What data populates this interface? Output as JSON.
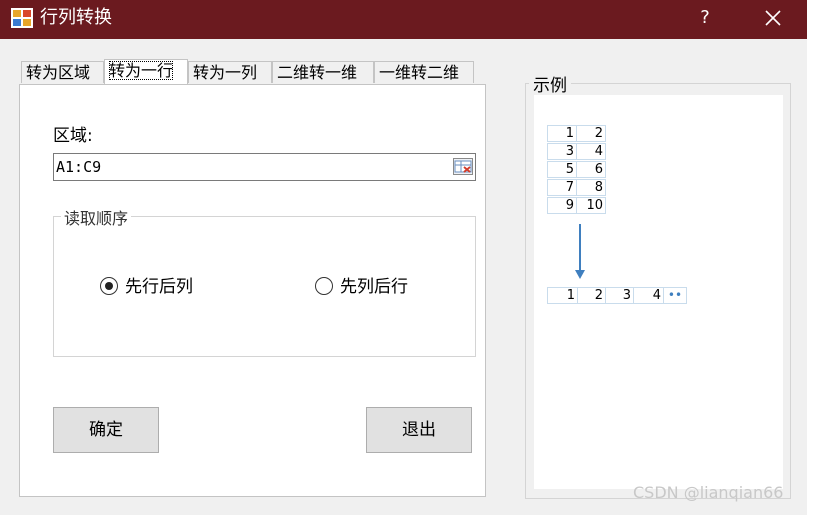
{
  "window": {
    "title": "行列转换",
    "help_label": "?"
  },
  "tabs": [
    {
      "label": "转为区域"
    },
    {
      "label": "转为一行"
    },
    {
      "label": "转为一列"
    },
    {
      "label": "二维转一维"
    },
    {
      "label": "一维转二维"
    }
  ],
  "active_tab_index": 1,
  "form": {
    "region_label": "区域:",
    "region_value": "A1:C9",
    "read_order_title": "读取顺序",
    "options": [
      {
        "label": "先行后列",
        "selected": true
      },
      {
        "label": "先列后行",
        "selected": false
      }
    ],
    "ok_label": "确定",
    "exit_label": "退出"
  },
  "example": {
    "title": "示例",
    "grid": [
      [
        "1",
        "2"
      ],
      [
        "3",
        "4"
      ],
      [
        "5",
        "6"
      ],
      [
        "7",
        "8"
      ],
      [
        "9",
        "10"
      ]
    ],
    "row_result": [
      "1",
      "2",
      "3",
      "4"
    ],
    "ellipsis": "••"
  },
  "watermark": "CSDN @lianqian66",
  "colors": {
    "titlebar": "#6b1a1f",
    "arrow": "#3f7fbf",
    "grid_border": "#c9dcec"
  }
}
